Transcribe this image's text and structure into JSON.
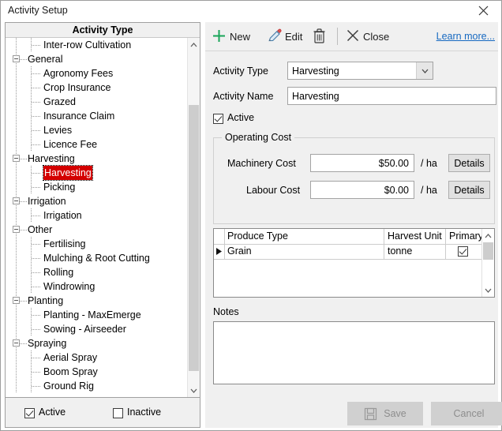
{
  "window": {
    "title": "Activity Setup",
    "close_icon": "close-icon"
  },
  "tree": {
    "header": "Activity Type",
    "items": [
      {
        "label": "Inter-row Cultivation",
        "level": 2,
        "expander": false,
        "selected": false
      },
      {
        "label": "General",
        "level": 1,
        "expander": true,
        "selected": false
      },
      {
        "label": "Agronomy Fees",
        "level": 2,
        "expander": false,
        "selected": false
      },
      {
        "label": "Crop Insurance",
        "level": 2,
        "expander": false,
        "selected": false
      },
      {
        "label": "Grazed",
        "level": 2,
        "expander": false,
        "selected": false
      },
      {
        "label": "Insurance Claim",
        "level": 2,
        "expander": false,
        "selected": false
      },
      {
        "label": "Levies",
        "level": 2,
        "expander": false,
        "selected": false
      },
      {
        "label": "Licence Fee",
        "level": 2,
        "expander": false,
        "selected": false
      },
      {
        "label": "Harvesting",
        "level": 1,
        "expander": true,
        "selected": false
      },
      {
        "label": "Harvesting",
        "level": 2,
        "expander": false,
        "selected": true
      },
      {
        "label": "Picking",
        "level": 2,
        "expander": false,
        "selected": false
      },
      {
        "label": "Irrigation",
        "level": 1,
        "expander": true,
        "selected": false
      },
      {
        "label": "Irrigation",
        "level": 2,
        "expander": false,
        "selected": false
      },
      {
        "label": "Other",
        "level": 1,
        "expander": true,
        "selected": false
      },
      {
        "label": "Fertilising",
        "level": 2,
        "expander": false,
        "selected": false
      },
      {
        "label": "Mulching & Root Cutting",
        "level": 2,
        "expander": false,
        "selected": false
      },
      {
        "label": "Rolling",
        "level": 2,
        "expander": false,
        "selected": false
      },
      {
        "label": "Windrowing",
        "level": 2,
        "expander": false,
        "selected": false
      },
      {
        "label": "Planting",
        "level": 1,
        "expander": true,
        "selected": false
      },
      {
        "label": "Planting - MaxEmerge",
        "level": 2,
        "expander": false,
        "selected": false
      },
      {
        "label": "Sowing - Airseeder",
        "level": 2,
        "expander": false,
        "selected": false
      },
      {
        "label": "Spraying",
        "level": 1,
        "expander": true,
        "selected": false
      },
      {
        "label": "Aerial Spray",
        "level": 2,
        "expander": false,
        "selected": false
      },
      {
        "label": "Boom Spray",
        "level": 2,
        "expander": false,
        "selected": false
      },
      {
        "label": "Ground Rig",
        "level": 2,
        "expander": false,
        "selected": false
      }
    ],
    "selected_color": "#d40000"
  },
  "filter_bar": {
    "active_label": "Active",
    "active_checked": true,
    "inactive_label": "Inactive",
    "inactive_checked": false
  },
  "toolbar": {
    "new_label": "New",
    "new_icon": "plus-icon",
    "new_icon_color": "#18a558",
    "edit_label": "Edit",
    "edit_icon": "pencil-icon",
    "delete_icon": "trash-icon",
    "close_label": "Close",
    "close_icon": "close-x-icon",
    "learn_more_label": "Learn more...",
    "learn_more_color": "#1669c1"
  },
  "form": {
    "activity_type_label": "Activity Type",
    "activity_type_value": "Harvesting",
    "activity_name_label": "Activity Name",
    "activity_name_value": "Harvesting",
    "active_label": "Active",
    "active_checked": true
  },
  "operating_cost": {
    "title": "Operating Cost",
    "machinery_label": "Machinery Cost",
    "machinery_value": "$50.00",
    "machinery_unit": "/ ha",
    "machinery_details_label": "Details",
    "labour_label": "Labour Cost",
    "labour_value": "$0.00",
    "labour_unit": "/ ha",
    "labour_details_label": "Details"
  },
  "produce_grid": {
    "columns": [
      "Produce Type",
      "Harvest Unit",
      "Primary"
    ],
    "rows": [
      {
        "produce_type": "Grain",
        "harvest_unit": "tonne",
        "primary": true,
        "marker": "▶"
      }
    ]
  },
  "notes": {
    "label": "Notes",
    "value": ""
  },
  "footer": {
    "save_label": "Save",
    "save_icon": "floppy-save-icon",
    "cancel_label": "Cancel"
  }
}
